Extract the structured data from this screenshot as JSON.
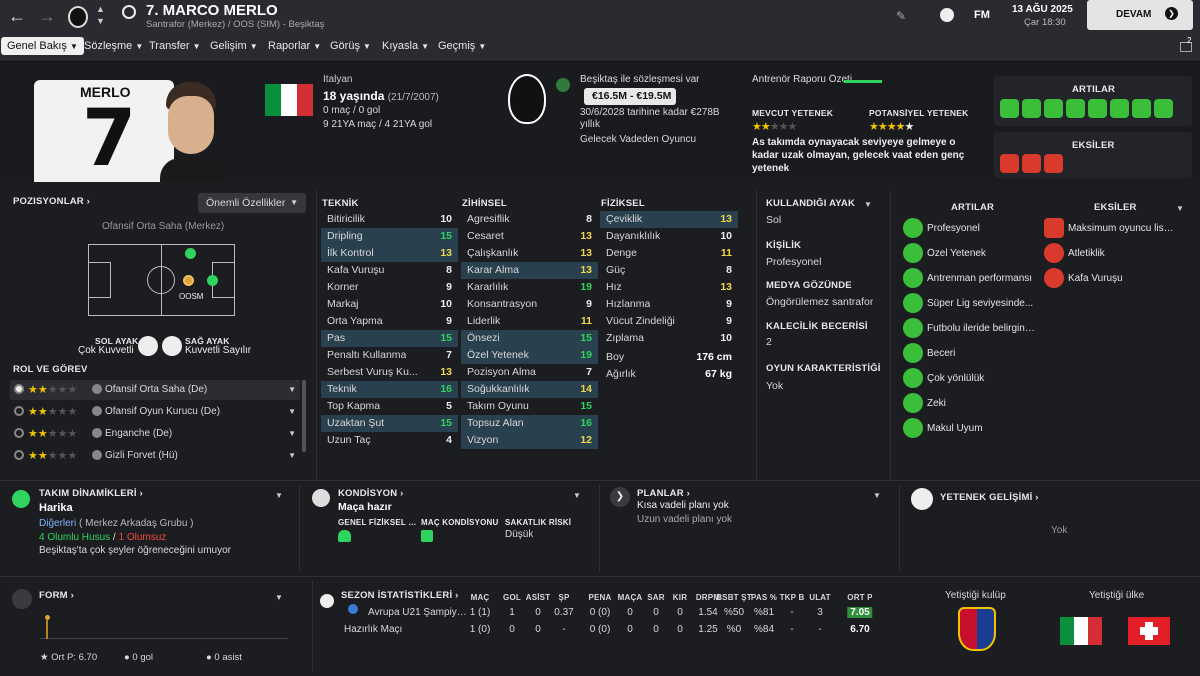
{
  "header": {
    "player_title": "7. MARCO MERLO",
    "subtitle": "Santrafor (Merkez) / OOS (SIM) - Beşiktaş",
    "date": "13 AĞU 2025",
    "day_time": "Çar 18:30",
    "continue_label": "DEVAM",
    "fm_label": "FM"
  },
  "nav": {
    "items": [
      "Genel Bakış",
      "Sözleşme",
      "Transfer",
      "Gelişim",
      "Raporlar",
      "Görüş",
      "Kıyasla",
      "Geçmiş"
    ],
    "badge": "2"
  },
  "profile": {
    "shirt_name": "MERLO",
    "shirt_number": "7",
    "nationality": "İtalyan",
    "age": "18 yaşında",
    "birth": "(21/7/2007)",
    "apps": "0 maç / 0 gol",
    "u21": "9 21YA maç / 4 21YA gol",
    "club_line": "Beşiktaş ile sözleşmesi var",
    "value": "€16.5M - €19.5M",
    "contract": "30/6/2028 tarihine kadar €278B yıllık",
    "role_desc": "Gelecek Vadeden Oyuncu"
  },
  "coach_report": {
    "title": "Antrenör Raporu Özeti",
    "current_label": "MEVCUT YETENEK",
    "potential_label": "POTANSİYEL YETENEK",
    "current_stars": 2,
    "potential_stars": 4.5,
    "summary": "As takımda oynayacak seviyeye gelmeye o kadar uzak olmayan, gelecek vaat eden genç yetenek",
    "pros_title": "ARTILAR",
    "cons_title": "EKSİLER"
  },
  "positions": {
    "title": "Pozisyonlar",
    "dropdown": "Önemli Özellikler",
    "main_position": "Ofansif Orta Saha (Merkez)",
    "pitch_label": "OOSM",
    "left_foot_label": "SOL AYAK",
    "left_foot_value": "Çok Kuvvetli",
    "right_foot_label": "SAĞ AYAK",
    "right_foot_value": "Kuvvetli Sayılır"
  },
  "roles": {
    "title": "ROL VE GÖREV",
    "items": [
      {
        "name": "Ofansif Orta Saha (De)",
        "stars": 2
      },
      {
        "name": "Ofansif Oyun Kurucu (De)",
        "stars": 2
      },
      {
        "name": "Enganche (De)",
        "stars": 1.5
      },
      {
        "name": "Gizli Forvet (Hü)",
        "stars": 1.5
      }
    ]
  },
  "attributes": {
    "technical_title": "TEKNİK",
    "mental_title": "ZİHİNSEL",
    "physical_title": "FİZİKSEL",
    "technical": [
      {
        "n": "Bitiricilik",
        "v": "10",
        "h": false
      },
      {
        "n": "Dripling",
        "v": "15",
        "h": true
      },
      {
        "n": "İlk Kontrol",
        "v": "13",
        "h": true
      },
      {
        "n": "Kafa Vuruşu",
        "v": "8",
        "h": false
      },
      {
        "n": "Korner",
        "v": "9",
        "h": false
      },
      {
        "n": "Markaj",
        "v": "10",
        "h": false
      },
      {
        "n": "Orta Yapma",
        "v": "9",
        "h": false
      },
      {
        "n": "Pas",
        "v": "15",
        "h": true
      },
      {
        "n": "Penaltı Kullanma",
        "v": "7",
        "h": false
      },
      {
        "n": "Serbest Vuruş Ku...",
        "v": "13",
        "h": false
      },
      {
        "n": "Teknik",
        "v": "16",
        "h": true
      },
      {
        "n": "Top Kapma",
        "v": "5",
        "h": false
      },
      {
        "n": "Uzaktan Şut",
        "v": "15",
        "h": true
      },
      {
        "n": "Uzun Taç",
        "v": "4",
        "h": false
      }
    ],
    "mental": [
      {
        "n": "Agresiflik",
        "v": "8",
        "h": false
      },
      {
        "n": "Cesaret",
        "v": "13",
        "h": false
      },
      {
        "n": "Çalışkanlık",
        "v": "13",
        "h": false
      },
      {
        "n": "Karar Alma",
        "v": "13",
        "h": true
      },
      {
        "n": "Kararlılık",
        "v": "19",
        "h": false
      },
      {
        "n": "Konsantrasyon",
        "v": "9",
        "h": false
      },
      {
        "n": "Liderlik",
        "v": "11",
        "h": false
      },
      {
        "n": "Önsezi",
        "v": "15",
        "h": true
      },
      {
        "n": "Özel Yetenek",
        "v": "19",
        "h": true
      },
      {
        "n": "Pozisyon Alma",
        "v": "7",
        "h": false
      },
      {
        "n": "Soğukkanlılık",
        "v": "14",
        "h": true
      },
      {
        "n": "Takım Oyunu",
        "v": "15",
        "h": false
      },
      {
        "n": "Topsuz Alan",
        "v": "16",
        "h": true
      },
      {
        "n": "Vizyon",
        "v": "12",
        "h": true
      }
    ],
    "physical": [
      {
        "n": "Çeviklik",
        "v": "13",
        "h": true
      },
      {
        "n": "Dayanıklılık",
        "v": "10",
        "h": false
      },
      {
        "n": "Denge",
        "v": "11",
        "h": false
      },
      {
        "n": "Güç",
        "v": "8",
        "h": false
      },
      {
        "n": "Hız",
        "v": "13",
        "h": false
      },
      {
        "n": "Hızlanma",
        "v": "9",
        "h": false
      },
      {
        "n": "Vücut Zindeliği",
        "v": "9",
        "h": false
      },
      {
        "n": "Zıplama",
        "v": "10",
        "h": false
      }
    ],
    "height_label": "Boy",
    "height": "176 cm",
    "weight_label": "Ağırlık",
    "weight": "67 kg"
  },
  "side": {
    "foot_title": "KULLANDIĞI AYAK",
    "foot": "Sol",
    "personality_title": "KİŞİLİK",
    "personality": "Profesyonel",
    "media_title": "MEDYA GÖZÜNDE",
    "media": "Öngörülemez santrafor",
    "gk_title": "KALECİLİK BECERİSİ",
    "gk": "2",
    "traits_title": "OYUN KARAKTERİSTİĞİ",
    "traits": "Yok"
  },
  "pros_cons": {
    "pros_title": "ARTILAR",
    "cons_title": "EKSİLER",
    "pros": [
      "Profesyonel",
      "Özel Yetenek",
      "Antrenman performansı",
      "Süper Lig seviyesinde...",
      "Futbolu ileride belirgin bir...",
      "Beceri",
      "Çok yönlülük",
      "Zeki",
      "Makul Uyum"
    ],
    "cons": [
      "Maksimum oyuncu lisansı...",
      "Atletiklik",
      "Kafa Vuruşu"
    ]
  },
  "dynamics": {
    "title": "TAKIM DİNAMİKLERİ",
    "status": "Harika",
    "group_link": "Diğerleri",
    "group_text": "( Merkez Arkadaş Grubu )",
    "positives": "4 Olumlu Husus",
    "slash": "/",
    "negatives": "1 Olumsuz",
    "note": "Beşiktaş'ta çok şeyler öğreneceğini umuyor"
  },
  "condition": {
    "title": "KONDİSYON",
    "status": "Maça hazır",
    "fitness_label": "GENEL FİZİKSEL K...",
    "match_label": "MAÇ KONDİSYONU",
    "injury_label": "SAKATLIK RİSKİ",
    "injury": "Düşük"
  },
  "plans": {
    "title": "PLANLAR",
    "short": "Kısa vadeli planı yok",
    "long": "Uzun vadeli planı yok"
  },
  "development": {
    "title": "YETENEK GELİŞİMİ",
    "value": "Yok"
  },
  "form": {
    "title": "FORM",
    "avg": "Ort P: 6.70",
    "goals": "0 gol",
    "assists": "0 asist"
  },
  "season": {
    "title": "SEZON İSTATİSTİKLERİ",
    "columns": [
      "MAÇ",
      "GOL",
      "ASİST",
      "ŞP",
      "PENA",
      "MAÇA",
      "SAR",
      "KIR",
      "DRPM",
      "BSBT ŞT",
      "PAS %",
      "TKP B",
      "ULAT",
      "ORT P"
    ],
    "rows": [
      {
        "name": "Avrupa U21 Şampiyon...",
        "cells": [
          "1 (1)",
          "1",
          "0",
          "0.37",
          "0 (0)",
          "0",
          "0",
          "0",
          "1.54",
          "%50",
          "%81",
          "-",
          "3",
          "7.05"
        ]
      },
      {
        "name": "Hazırlık Maçı",
        "cells": [
          "1 (0)",
          "0",
          "0",
          "-",
          "0 (0)",
          "0",
          "0",
          "0",
          "1.25",
          "%0",
          "%84",
          "-",
          "-",
          "6.70"
        ]
      }
    ]
  },
  "origin": {
    "club_label": "Yetiştiği kulüp",
    "country_label": "Yetiştiği ülke"
  }
}
